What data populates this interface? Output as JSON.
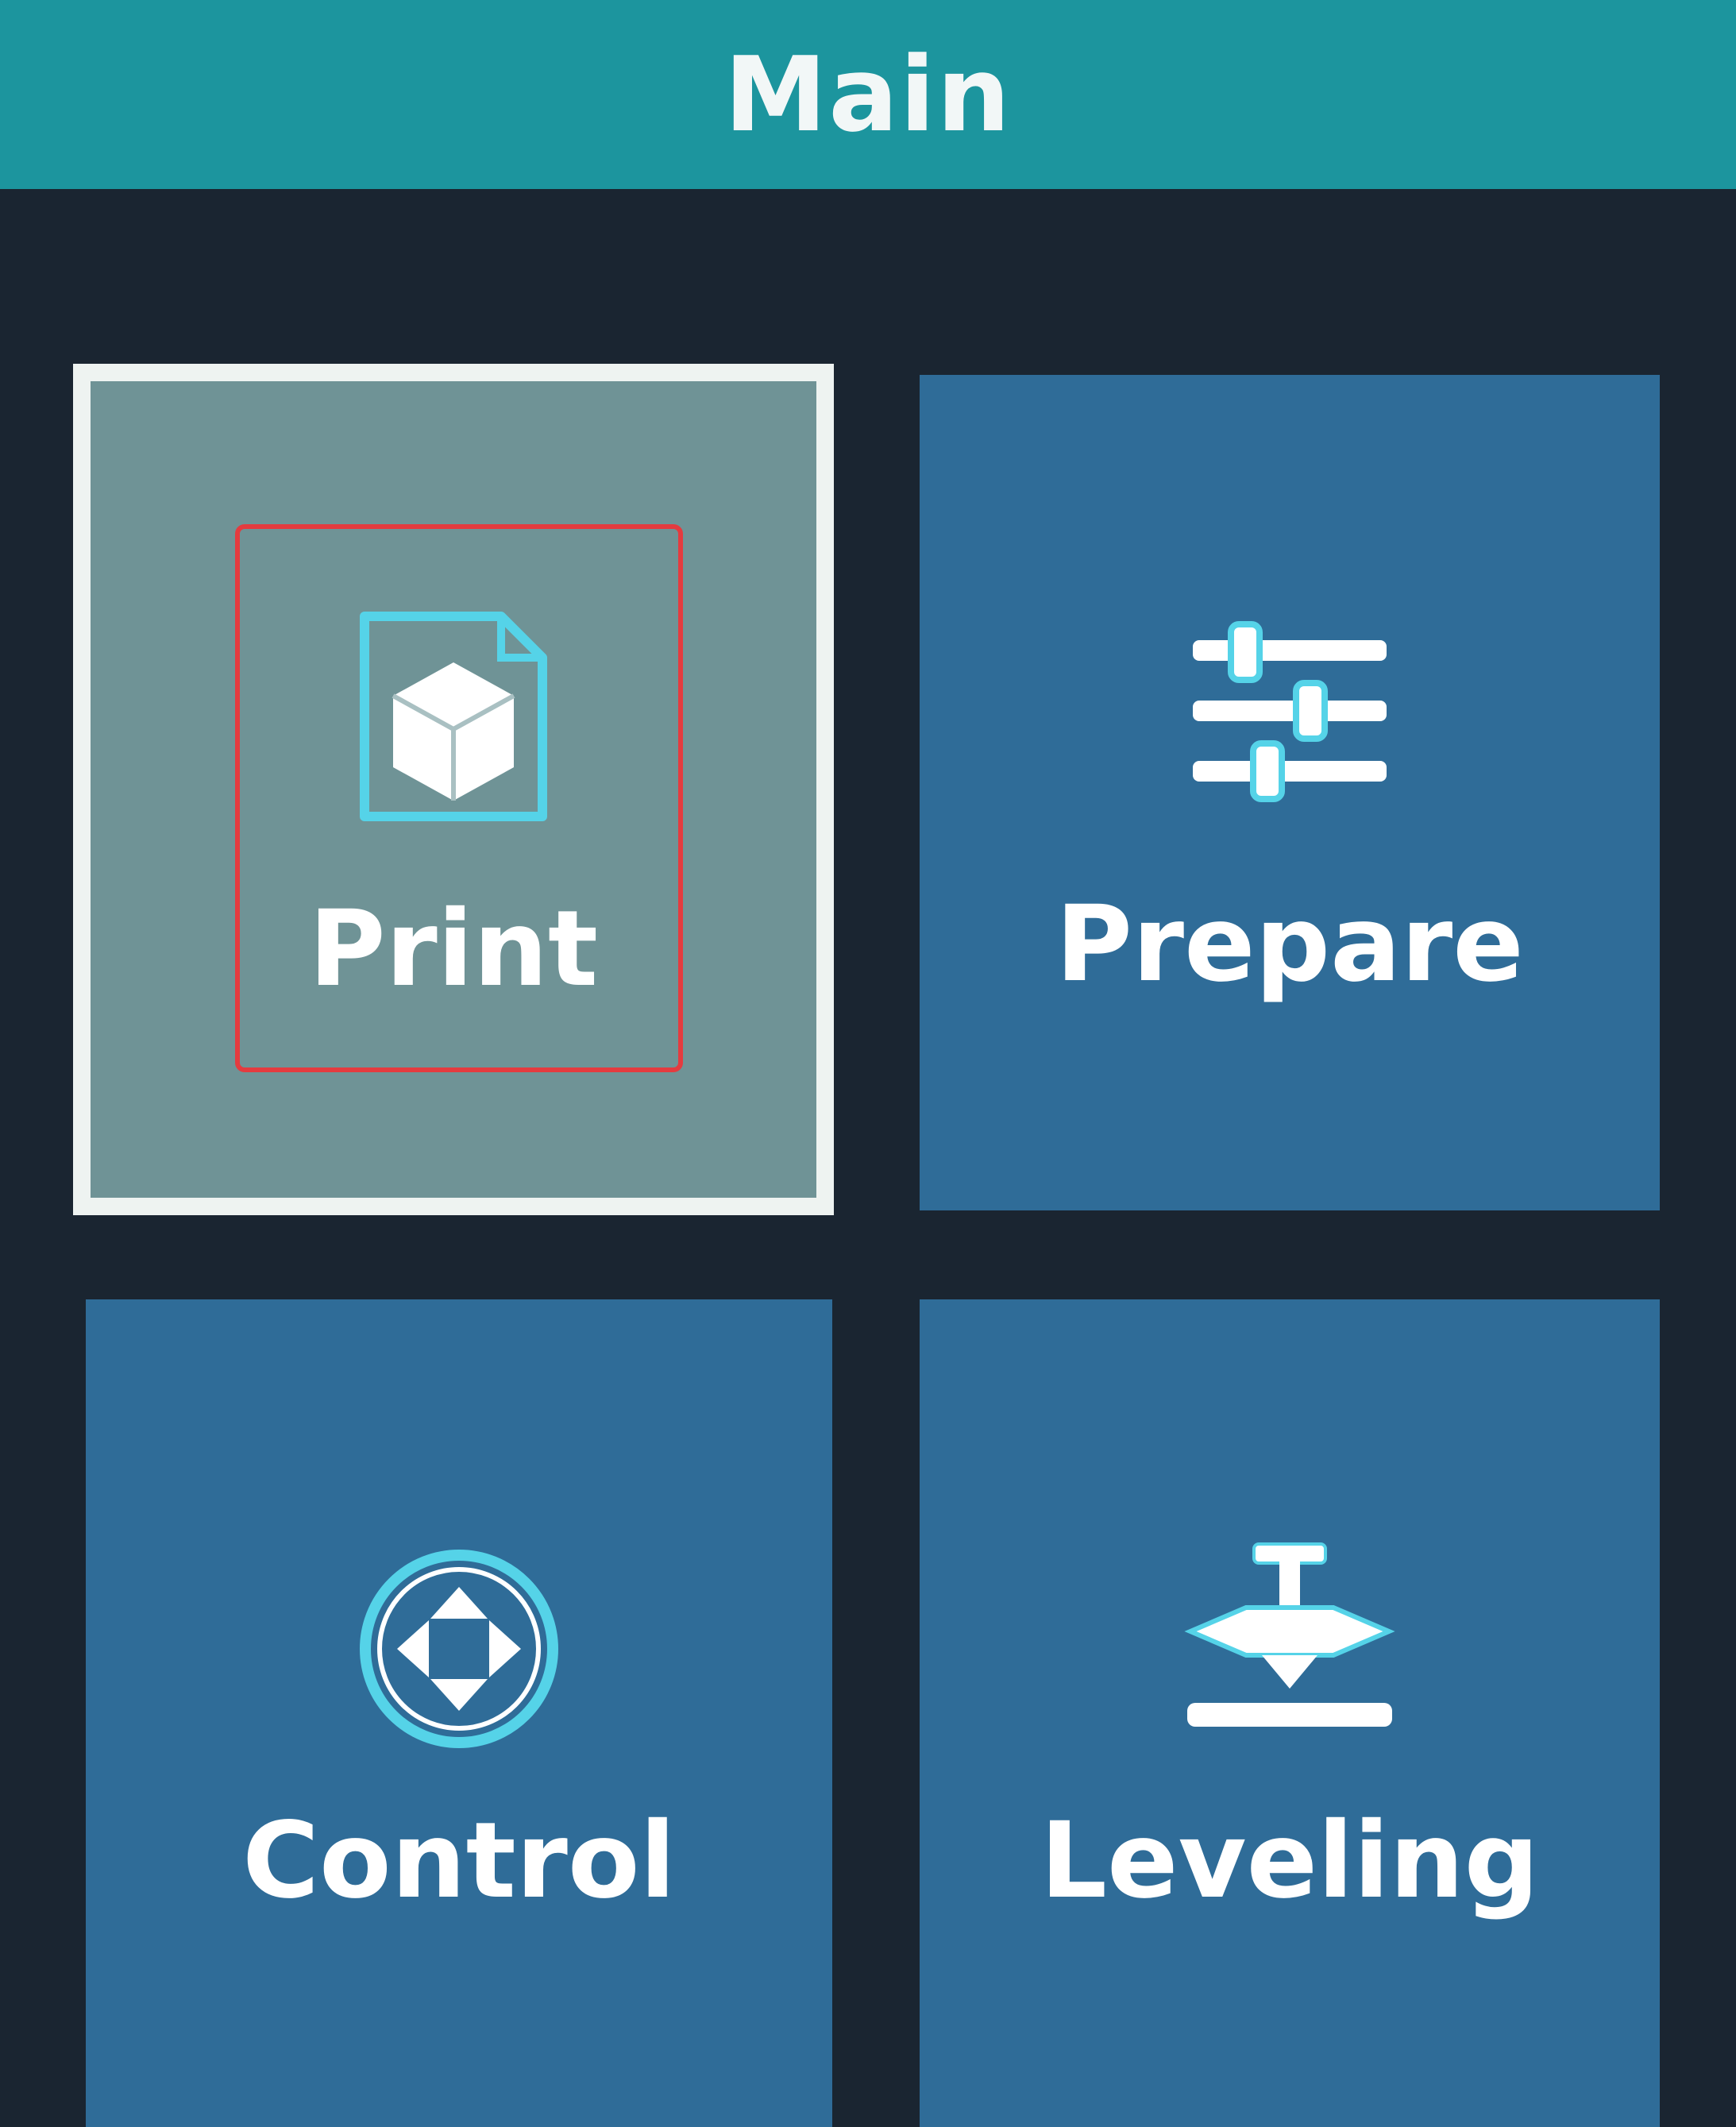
{
  "header": {
    "title": "Main"
  },
  "menu": {
    "items": [
      {
        "id": "print",
        "label": "Print",
        "icon": "print-file-icon",
        "selected": true
      },
      {
        "id": "prepare",
        "label": "Prepare",
        "icon": "sliders-icon",
        "selected": false
      },
      {
        "id": "control",
        "label": "Control",
        "icon": "dpad-icon",
        "selected": false
      },
      {
        "id": "leveling",
        "label": "Leveling",
        "icon": "leveling-icon",
        "selected": false
      }
    ]
  },
  "colors": {
    "titlebar": "#1c959e",
    "background": "#1a2531",
    "tile": "#2f6c98",
    "tile_selected": "#6f9396",
    "icon_accent": "#55d3e8",
    "highlight_box": "#e43b3f"
  }
}
